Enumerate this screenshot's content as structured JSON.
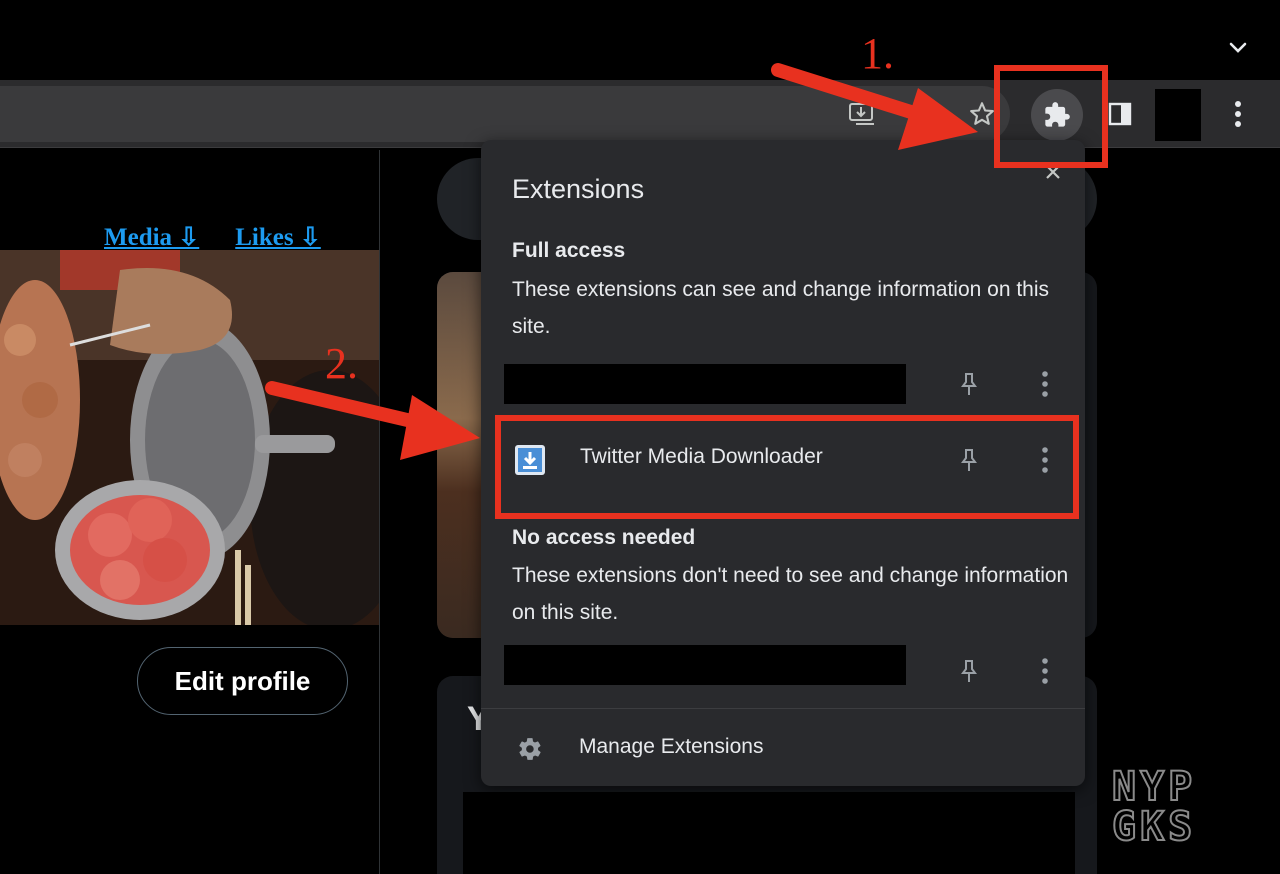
{
  "browser": {
    "toolbar_icons": [
      "install-app-icon",
      "bookmark-star-icon",
      "extensions-puzzle-icon",
      "side-panel-icon",
      "profile-avatar",
      "kebab-menu-icon"
    ],
    "tabstrip_icon": "chevron-down-icon"
  },
  "page": {
    "media_link": "Media ⇩",
    "likes_link": "Likes ⇩",
    "edit_profile_label": "Edit profile",
    "card_heading_initial": "Y"
  },
  "extensions_popup": {
    "title": "Extensions",
    "full_access": {
      "heading": "Full access",
      "description": "These extensions can see and change information on this site."
    },
    "highlighted_extension": {
      "name": "Twitter Media Downloader",
      "icon": "download-arrow-icon"
    },
    "no_access": {
      "heading": "No access needed",
      "description": "These extensions don't need to see and change information on this site."
    },
    "manage_label": "Manage Extensions"
  },
  "annotations": {
    "step1": "1.",
    "step2": "2.",
    "highlight_color": "#e8311f"
  },
  "watermark": {
    "line1": "NYP",
    "line2": "GKS"
  },
  "colors": {
    "popup_bg": "#292a2d",
    "toolbar_bg": "#2b2b2d",
    "link_blue": "#1d9bf0",
    "annotation_red": "#e8311f"
  }
}
